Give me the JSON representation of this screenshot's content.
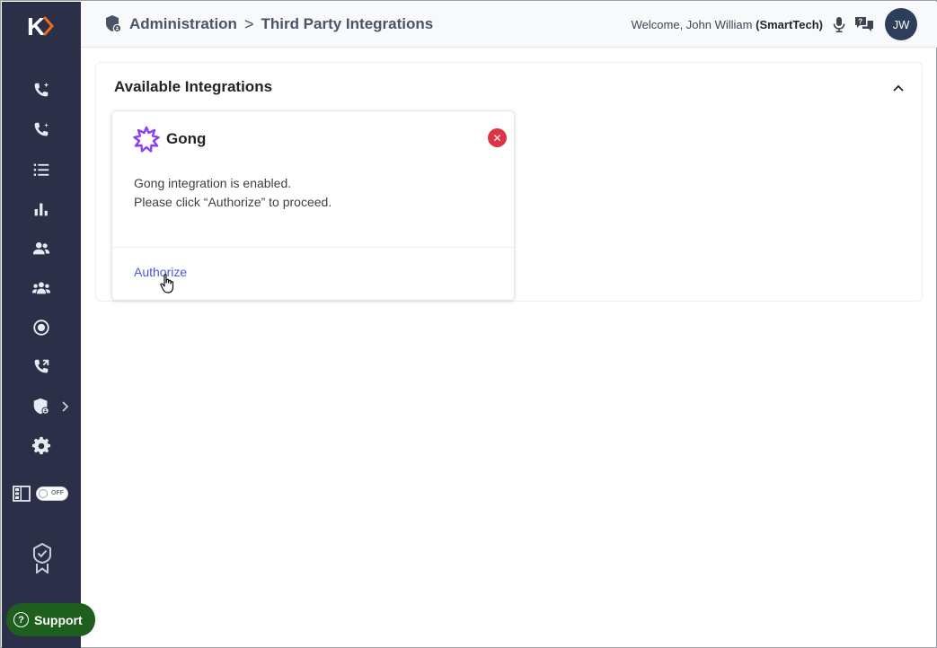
{
  "brand": {
    "logo_letter": "K",
    "accent": "#f26b1d"
  },
  "header": {
    "breadcrumb": [
      {
        "label": "Administration"
      },
      {
        "label": "Third Party Integrations"
      }
    ],
    "separator": ">",
    "welcome_prefix": "Welcome, John William",
    "org_name": "(SmartTech)",
    "avatar_initials": "JW"
  },
  "sidebar": {
    "items": [
      {
        "icon": "phone-sparkle-icon"
      },
      {
        "icon": "phone-add-icon"
      },
      {
        "icon": "list-icon"
      },
      {
        "icon": "bar-chart-icon"
      },
      {
        "icon": "user-group-icon"
      },
      {
        "icon": "users-icon"
      },
      {
        "icon": "record-icon"
      },
      {
        "icon": "phone-forward-icon"
      },
      {
        "icon": "shield-admin-icon"
      },
      {
        "icon": "gear-icon"
      }
    ],
    "toggle_label": "OFF",
    "support_label": "Support"
  },
  "main": {
    "section_title": "Available Integrations",
    "card": {
      "name": "Gong",
      "line1": "Gong integration is enabled.",
      "line2": "Please click “Authorize” to proceed.",
      "action_label": "Authorize",
      "close_symbol": "✕"
    }
  },
  "colors": {
    "sidebar_bg": "#2c2f48",
    "support_bg": "#1e5f1e",
    "link": "#4a56e2",
    "close": "#dc3545",
    "gong_purple": "#8a3ffc"
  }
}
